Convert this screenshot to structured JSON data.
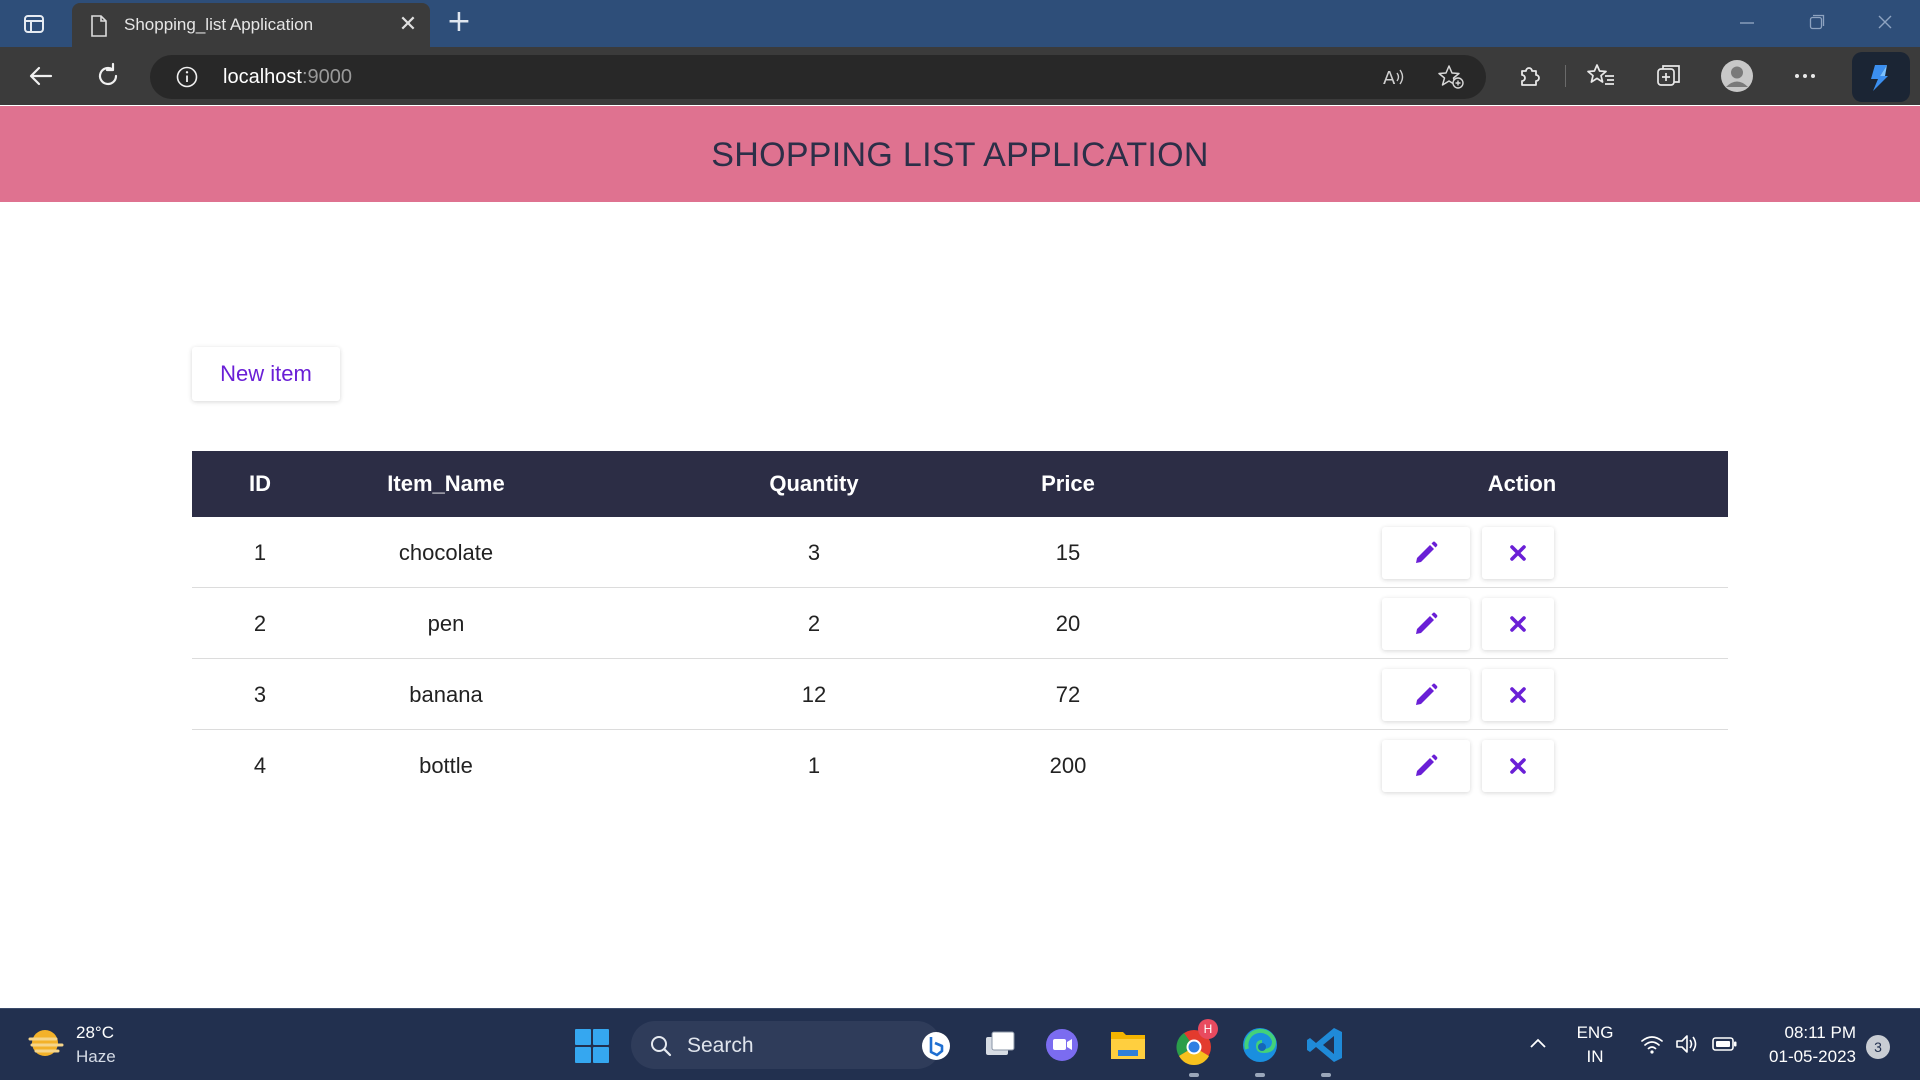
{
  "browser": {
    "tab_title": "Shopping_list Application",
    "tab_close": "✕",
    "new_tab": "+",
    "address_host": "localhost",
    "address_port": ":9000"
  },
  "page": {
    "title": "SHOPPING LIST APPLICATION",
    "new_item_label": "New item",
    "table": {
      "headers": [
        "ID",
        "Item_Name",
        "Quantity",
        "Price",
        "Action"
      ],
      "rows": [
        {
          "id": "1",
          "name": "chocolate",
          "quantity": "3",
          "price": "15"
        },
        {
          "id": "2",
          "name": "pen",
          "quantity": "2",
          "price": "20"
        },
        {
          "id": "3",
          "name": "banana",
          "quantity": "12",
          "price": "72"
        },
        {
          "id": "4",
          "name": "bottle",
          "quantity": "1",
          "price": "200"
        }
      ]
    },
    "colors": {
      "header_bg": "#df7290",
      "table_header_bg": "#2c2d45",
      "accent": "#6a1fd6"
    }
  },
  "taskbar": {
    "weather_temp": "28°C",
    "weather_desc": "Haze",
    "search_label": "Search",
    "chrome_badge": "H",
    "language": "ENG",
    "region": "IN",
    "time": "08:11 PM",
    "date": "01-05-2023",
    "notification_count": "3"
  }
}
